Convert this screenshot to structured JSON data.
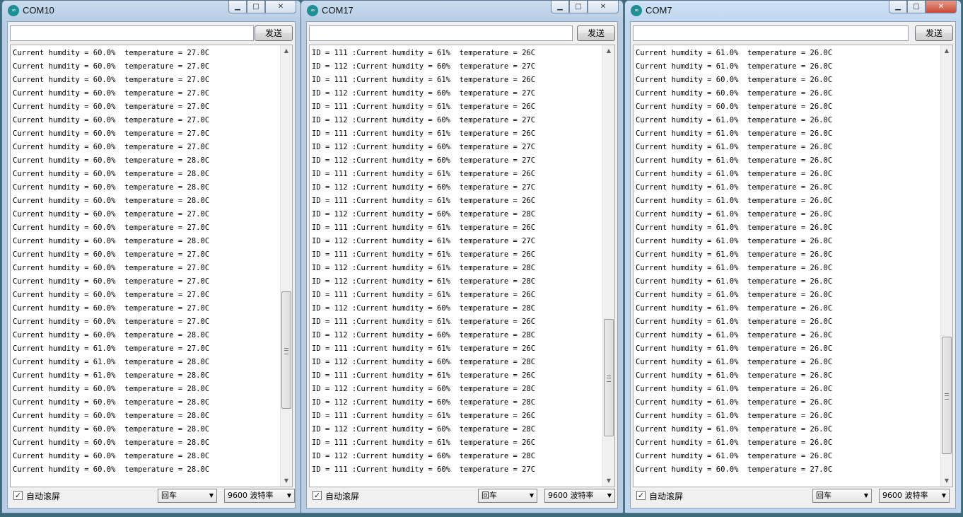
{
  "windows": [
    {
      "title": "COM10",
      "send_label": "发送",
      "input_value": "",
      "autoscroll_label": "自动滚屏",
      "autoscroll_checked": true,
      "line_ending": "回车",
      "baud_rate": "9600 波特率",
      "scroll_position": 0.78,
      "lines": [
        "Current humdity = 60.0%  temperature = 27.0C",
        "Current humdity = 60.0%  temperature = 27.0C",
        "Current humdity = 60.0%  temperature = 27.0C",
        "Current humdity = 60.0%  temperature = 27.0C",
        "Current humdity = 60.0%  temperature = 27.0C",
        "Current humdity = 60.0%  temperature = 27.0C",
        "Current humdity = 60.0%  temperature = 27.0C",
        "Current humdity = 60.0%  temperature = 27.0C",
        "Current humdity = 60.0%  temperature = 28.0C",
        "Current humdity = 60.0%  temperature = 28.0C",
        "Current humdity = 60.0%  temperature = 28.0C",
        "Current humdity = 60.0%  temperature = 28.0C",
        "Current humdity = 60.0%  temperature = 27.0C",
        "Current humdity = 60.0%  temperature = 27.0C",
        "Current humdity = 60.0%  temperature = 28.0C",
        "Current humdity = 60.0%  temperature = 27.0C",
        "Current humdity = 60.0%  temperature = 27.0C",
        "Current humdity = 60.0%  temperature = 27.0C",
        "Current humdity = 60.0%  temperature = 27.0C",
        "Current humdity = 60.0%  temperature = 27.0C",
        "Current humdity = 60.0%  temperature = 27.0C",
        "Current humdity = 60.0%  temperature = 28.0C",
        "Current humdity = 61.0%  temperature = 27.0C",
        "Current humdity = 61.0%  temperature = 28.0C",
        "Current humdity = 61.0%  temperature = 28.0C",
        "Current humdity = 60.0%  temperature = 28.0C",
        "Current humdity = 60.0%  temperature = 28.0C",
        "Current humdity = 60.0%  temperature = 28.0C",
        "Current humdity = 60.0%  temperature = 28.0C",
        "Current humdity = 60.0%  temperature = 28.0C",
        "Current humdity = 60.0%  temperature = 28.0C",
        "Current humdity = 60.0%  temperature = 28.0C"
      ]
    },
    {
      "title": "COM17",
      "send_label": "发送",
      "input_value": "",
      "autoscroll_label": "自动滚屏",
      "autoscroll_checked": true,
      "line_ending": "回车",
      "baud_rate": "9600 波特率",
      "scroll_position": 0.87,
      "lines": [
        "ID = 111 :Current humdity = 61%  temperature = 26C",
        "ID = 112 :Current humdity = 60%  temperature = 27C",
        "ID = 111 :Current humdity = 61%  temperature = 26C",
        "ID = 112 :Current humdity = 60%  temperature = 27C",
        "ID = 111 :Current humdity = 61%  temperature = 26C",
        "ID = 112 :Current humdity = 60%  temperature = 27C",
        "ID = 111 :Current humdity = 61%  temperature = 26C",
        "ID = 112 :Current humdity = 60%  temperature = 27C",
        "ID = 112 :Current humdity = 60%  temperature = 27C",
        "ID = 111 :Current humdity = 61%  temperature = 26C",
        "ID = 112 :Current humdity = 60%  temperature = 27C",
        "ID = 111 :Current humdity = 61%  temperature = 26C",
        "ID = 112 :Current humdity = 60%  temperature = 28C",
        "ID = 111 :Current humdity = 61%  temperature = 26C",
        "ID = 112 :Current humdity = 61%  temperature = 27C",
        "ID = 111 :Current humdity = 61%  temperature = 26C",
        "ID = 112 :Current humdity = 61%  temperature = 28C",
        "ID = 112 :Current humdity = 61%  temperature = 28C",
        "ID = 111 :Current humdity = 61%  temperature = 26C",
        "ID = 112 :Current humdity = 60%  temperature = 28C",
        "ID = 111 :Current humdity = 61%  temperature = 26C",
        "ID = 112 :Current humdity = 60%  temperature = 28C",
        "ID = 111 :Current humdity = 61%  temperature = 26C",
        "ID = 112 :Current humdity = 60%  temperature = 28C",
        "ID = 111 :Current humdity = 61%  temperature = 26C",
        "ID = 112 :Current humdity = 60%  temperature = 28C",
        "ID = 112 :Current humdity = 60%  temperature = 28C",
        "ID = 111 :Current humdity = 61%  temperature = 26C",
        "ID = 112 :Current humdity = 60%  temperature = 28C",
        "ID = 111 :Current humdity = 61%  temperature = 26C",
        "ID = 112 :Current humdity = 60%  temperature = 28C",
        "ID = 111 :Current humdity = 60%  temperature = 27C"
      ]
    },
    {
      "title": "COM7",
      "send_label": "发送",
      "input_value": "",
      "autoscroll_label": "自动滚屏",
      "autoscroll_checked": true,
      "line_ending": "回车",
      "baud_rate": "9600 波特率",
      "scroll_position": 0.93,
      "lines": [
        "Current humdity = 61.0%  temperature = 26.0C",
        "Current humdity = 61.0%  temperature = 26.0C",
        "Current humdity = 60.0%  temperature = 26.0C",
        "Current humdity = 60.0%  temperature = 26.0C",
        "Current humdity = 60.0%  temperature = 26.0C",
        "Current humdity = 61.0%  temperature = 26.0C",
        "Current humdity = 61.0%  temperature = 26.0C",
        "Current humdity = 61.0%  temperature = 26.0C",
        "Current humdity = 61.0%  temperature = 26.0C",
        "Current humdity = 61.0%  temperature = 26.0C",
        "Current humdity = 61.0%  temperature = 26.0C",
        "Current humdity = 61.0%  temperature = 26.0C",
        "Current humdity = 61.0%  temperature = 26.0C",
        "Current humdity = 61.0%  temperature = 26.0C",
        "Current humdity = 61.0%  temperature = 26.0C",
        "Current humdity = 61.0%  temperature = 26.0C",
        "Current humdity = 61.0%  temperature = 26.0C",
        "Current humdity = 61.0%  temperature = 26.0C",
        "Current humdity = 61.0%  temperature = 26.0C",
        "Current humdity = 61.0%  temperature = 26.0C",
        "Current humdity = 61.0%  temperature = 26.0C",
        "Current humdity = 61.0%  temperature = 26.0C",
        "Current humdity = 61.0%  temperature = 26.0C",
        "Current humdity = 61.0%  temperature = 26.0C",
        "Current humdity = 61.0%  temperature = 26.0C",
        "Current humdity = 61.0%  temperature = 26.0C",
        "Current humdity = 61.0%  temperature = 26.0C",
        "Current humdity = 61.0%  temperature = 26.0C",
        "Current humdity = 61.0%  temperature = 26.0C",
        "Current humdity = 61.0%  temperature = 26.0C",
        "Current humdity = 61.0%  temperature = 26.0C",
        "Current humdity = 60.0%  temperature = 27.0C"
      ]
    }
  ]
}
